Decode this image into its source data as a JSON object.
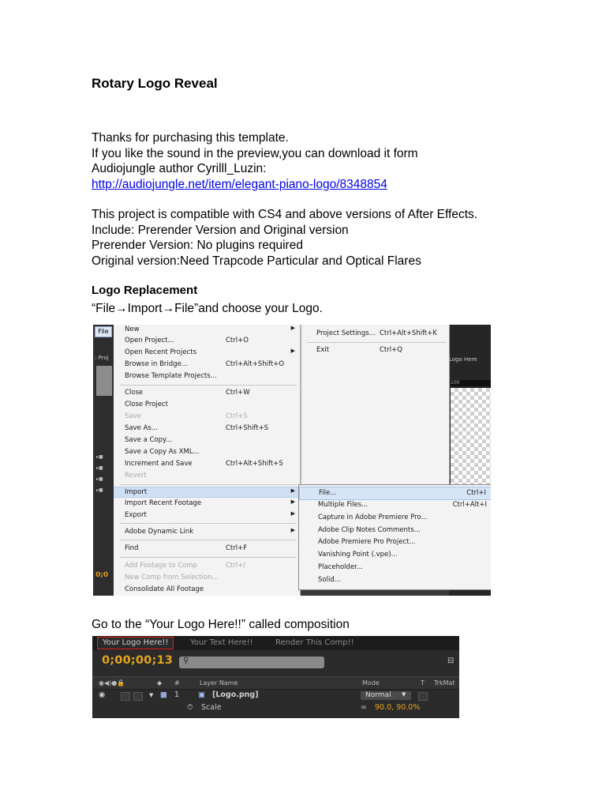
{
  "doc": {
    "title": "Rotary Logo Reveal",
    "intro": [
      "Thanks for purchasing this template.",
      "If you like the sound in the preview,you can download it form",
      "Audiojungle author Cyrilll_Luzin:"
    ],
    "link": "http://audiojungle.net/item/elegant-piano-logo/8348854",
    "compat": [
      "This project is compatible with CS4 and above versions of After Effects.",
      "Include: Prerender Version and Original version",
      "Prerender Version: No plugins required",
      "Original version:Need Trapcode Particular and Optical Flares"
    ],
    "section_heading": "Logo Replacement",
    "instruction_1": "“File→Import→File”and choose your Logo.",
    "instruction_2": "Go to the “Your Logo Here!!” called composition"
  },
  "menu_screenshot": {
    "file_tab": "File",
    "project_tab": ": Proj",
    "timecode": "0;0",
    "logo_tab": "Logo Here",
    "ruler_value": "100",
    "file_menu": [
      {
        "label": "New",
        "shortcut": "",
        "arrow": true,
        "disabled": false
      },
      {
        "label": "Open Project...",
        "shortcut": "Ctrl+O",
        "arrow": false,
        "disabled": false
      },
      {
        "label": "Open Recent Projects",
        "shortcut": "",
        "arrow": true,
        "disabled": false
      },
      {
        "label": "Browse in Bridge...",
        "shortcut": "Ctrl+Alt+Shift+O",
        "arrow": false,
        "disabled": false
      },
      {
        "label": "Browse Template Projects...",
        "shortcut": "",
        "arrow": false,
        "disabled": false
      },
      {
        "label": "Close",
        "shortcut": "Ctrl+W",
        "arrow": false,
        "disabled": false
      },
      {
        "label": "Close Project",
        "shortcut": "",
        "arrow": false,
        "disabled": false
      },
      {
        "label": "Save",
        "shortcut": "Ctrl+S",
        "arrow": false,
        "disabled": true
      },
      {
        "label": "Save As...",
        "shortcut": "Ctrl+Shift+S",
        "arrow": false,
        "disabled": false
      },
      {
        "label": "Save a Copy...",
        "shortcut": "",
        "arrow": false,
        "disabled": false
      },
      {
        "label": "Save a Copy As XML...",
        "shortcut": "",
        "arrow": false,
        "disabled": false
      },
      {
        "label": "Increment and Save",
        "shortcut": "Ctrl+Alt+Shift+S",
        "arrow": false,
        "disabled": false
      },
      {
        "label": "Revert",
        "shortcut": "",
        "arrow": false,
        "disabled": true
      },
      {
        "label": "Import",
        "shortcut": "",
        "arrow": true,
        "disabled": false,
        "highlight": true
      },
      {
        "label": "Import Recent Footage",
        "shortcut": "",
        "arrow": true,
        "disabled": false
      },
      {
        "label": "Export",
        "shortcut": "",
        "arrow": true,
        "disabled": false
      },
      {
        "label": "Adobe Dynamic Link",
        "shortcut": "",
        "arrow": true,
        "disabled": false
      },
      {
        "label": "Find",
        "shortcut": "Ctrl+F",
        "arrow": false,
        "disabled": false
      },
      {
        "label": "Add Footage to Comp",
        "shortcut": "Ctrl+/",
        "arrow": false,
        "disabled": true
      },
      {
        "label": "New Comp from Selection...",
        "shortcut": "",
        "arrow": false,
        "disabled": true
      },
      {
        "label": "Consolidate All Footage",
        "shortcut": "",
        "arrow": false,
        "disabled": false
      }
    ],
    "side_menu": [
      {
        "label": "Project Settings...",
        "shortcut": "Ctrl+Alt+Shift+K"
      },
      {
        "label": "Exit",
        "shortcut": "Ctrl+Q"
      }
    ],
    "import_menu": [
      {
        "label": "File...",
        "shortcut": "Ctrl+I",
        "highlight": true
      },
      {
        "label": "Multiple Files...",
        "shortcut": "Ctrl+Alt+I"
      },
      {
        "label": "Capture in Adobe Premiere Pro...",
        "shortcut": ""
      },
      {
        "label": "Adobe Clip Notes Comments...",
        "shortcut": ""
      },
      {
        "label": "Adobe Premiere Pro Project...",
        "shortcut": ""
      },
      {
        "label": "Vanishing Point (.vpe)...",
        "shortcut": ""
      },
      {
        "label": "Placeholder...",
        "shortcut": ""
      },
      {
        "label": "Solid...",
        "shortcut": ""
      }
    ]
  },
  "timeline_screenshot": {
    "tabs": [
      "Your Logo Here!!",
      "Your Text Here!!",
      "Render This Comp!!"
    ],
    "timecode": "0;00;00;13",
    "columns": {
      "layer_name": "Layer Name",
      "mode": "Mode",
      "t": "T",
      "trkmat": "TrkMat",
      "num": "#"
    },
    "layer": {
      "number": "1",
      "name": "[Logo.png]",
      "mode": "Normal"
    },
    "property": {
      "name": "Scale",
      "value": "90.0, 90.0%"
    }
  }
}
